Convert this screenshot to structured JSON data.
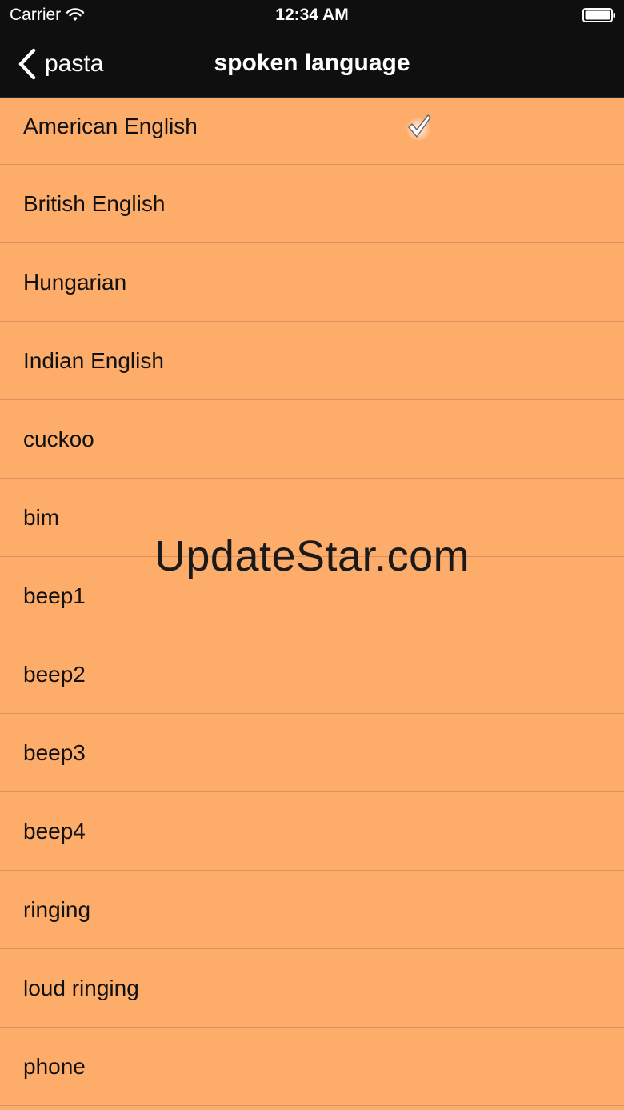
{
  "status_bar": {
    "carrier": "Carrier",
    "time": "12:34 AM",
    "icons": [
      "wifi-icon",
      "battery-icon"
    ]
  },
  "nav_bar": {
    "back_label": "pasta",
    "title": "spoken language",
    "back_icon": "chevron-left-icon"
  },
  "list": {
    "items": [
      {
        "label": "American English",
        "selected": true
      },
      {
        "label": "British English",
        "selected": false
      },
      {
        "label": "Hungarian",
        "selected": false
      },
      {
        "label": "Indian English",
        "selected": false
      },
      {
        "label": "cuckoo",
        "selected": false
      },
      {
        "label": "bim",
        "selected": false
      },
      {
        "label": "beep1",
        "selected": false
      },
      {
        "label": "beep2",
        "selected": false
      },
      {
        "label": "beep3",
        "selected": false
      },
      {
        "label": "beep4",
        "selected": false
      },
      {
        "label": "ringing",
        "selected": false
      },
      {
        "label": "loud ringing",
        "selected": false
      },
      {
        "label": "phone",
        "selected": false
      }
    ]
  },
  "watermark": "UpdateStar.com",
  "colors": {
    "background": "#FDAC6A",
    "bar": "#0F0F0F",
    "separator": "#D89163"
  }
}
